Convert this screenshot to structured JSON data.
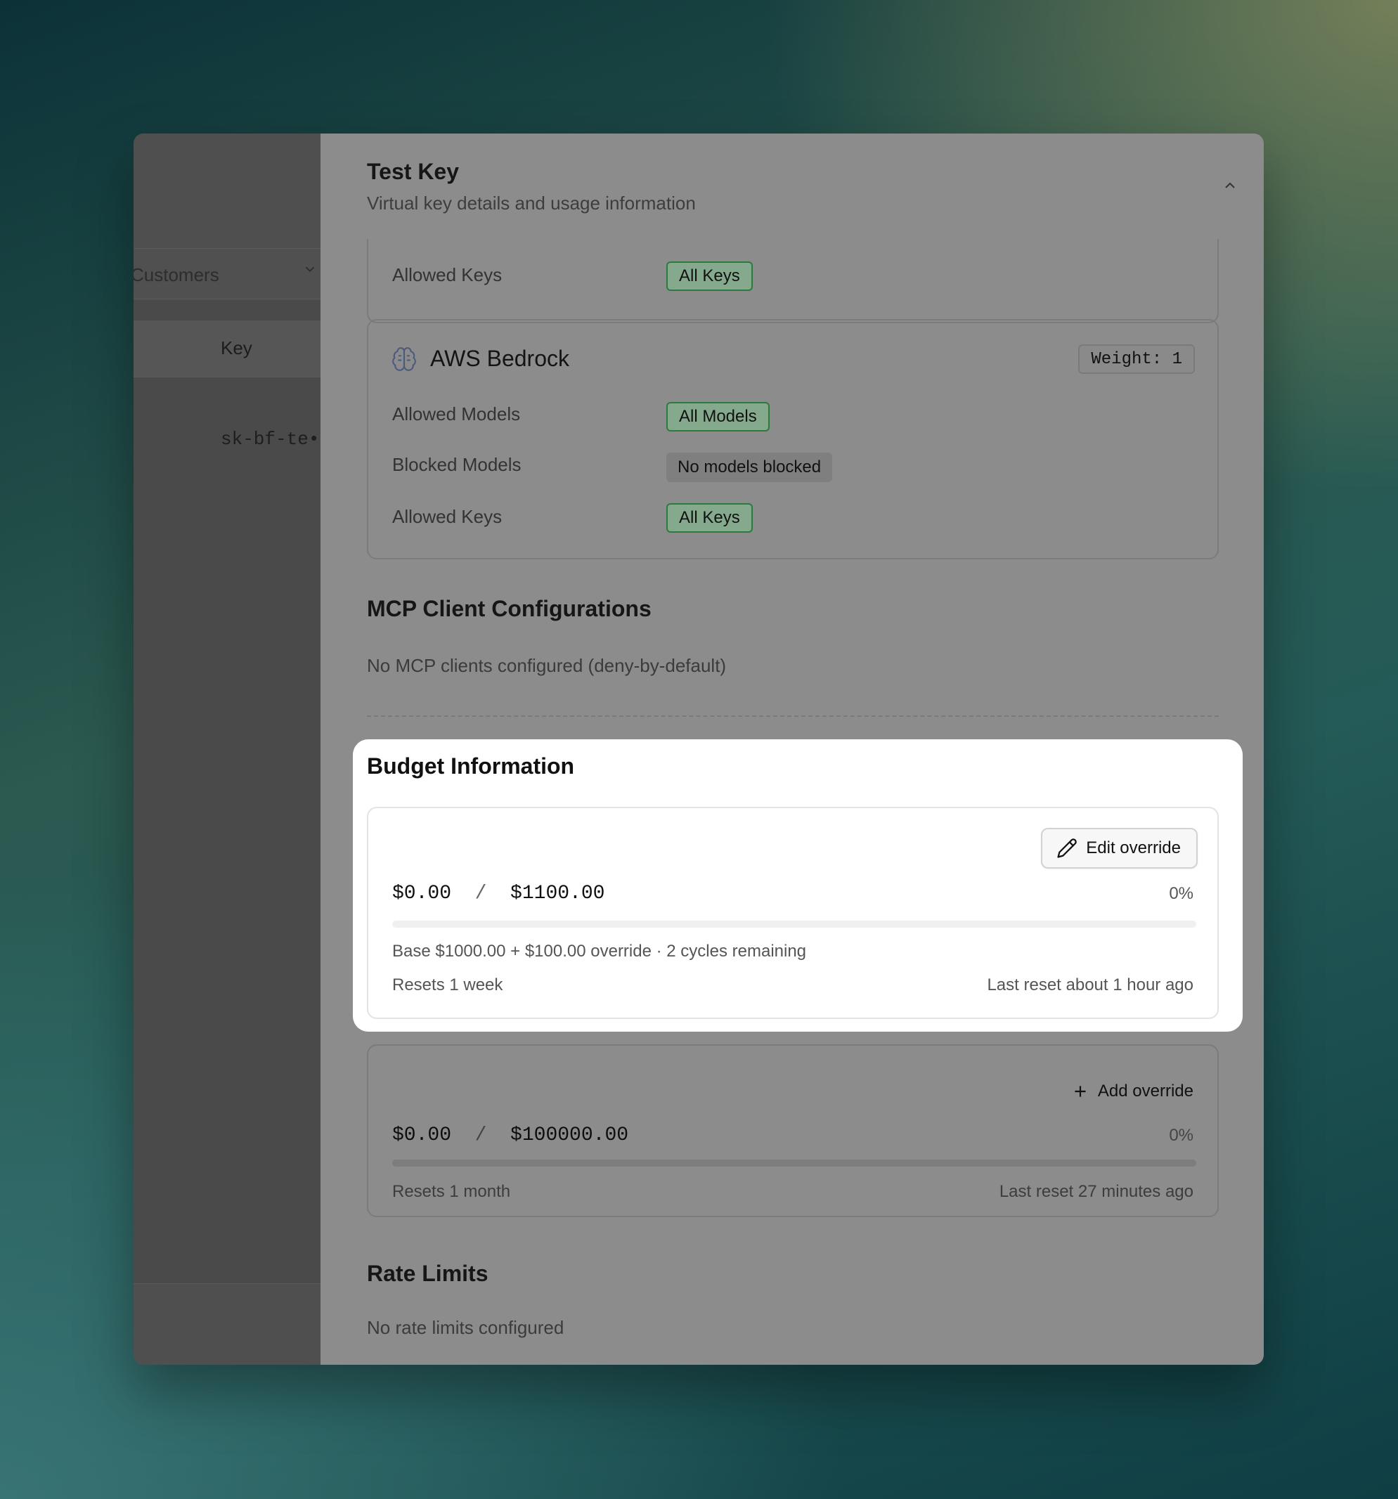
{
  "background_app": {
    "filter_label": "Customers",
    "column_header": "Key",
    "key_preview": "sk-bf-te•"
  },
  "sheet": {
    "title": "Test Key",
    "subtitle": "Virtual key details and usage information"
  },
  "provider_top": {
    "allowed_keys_label": "Allowed Keys",
    "allowed_keys_value": "All Keys"
  },
  "provider_bedrock": {
    "name": "AWS Bedrock",
    "weight": "Weight: 1",
    "allowed_models_label": "Allowed Models",
    "allowed_models_value": "All Models",
    "blocked_models_label": "Blocked Models",
    "blocked_models_value": "No models blocked",
    "allowed_keys_label": "Allowed Keys",
    "allowed_keys_value": "All Keys"
  },
  "mcp": {
    "title": "MCP Client Configurations",
    "empty": "No MCP clients configured (deny-by-default)"
  },
  "budget": {
    "title": "Budget Information",
    "primary": {
      "edit_label": "Edit override",
      "spent": "$0.00",
      "separator": "/",
      "limit": "$1100.00",
      "percent_label": "0%",
      "progress": 0,
      "detail": "Base $1000.00 + $100.00 override · 2 cycles remaining",
      "resets": "Resets 1 week",
      "last_reset": "Last reset about 1 hour ago"
    },
    "secondary": {
      "add_label": "Add override",
      "spent": "$0.00",
      "separator": "/",
      "limit": "$100000.00",
      "percent_label": "0%",
      "progress": 0,
      "resets": "Resets 1 month",
      "last_reset": "Last reset 27 minutes ago"
    }
  },
  "rate_limits": {
    "title": "Rate Limits",
    "empty": "No rate limits configured"
  },
  "colors": {
    "allowed_badge_border": "#2c7a3e",
    "overlay_panel": "#8c8c8c",
    "highlight_bg": "#ffffff"
  }
}
